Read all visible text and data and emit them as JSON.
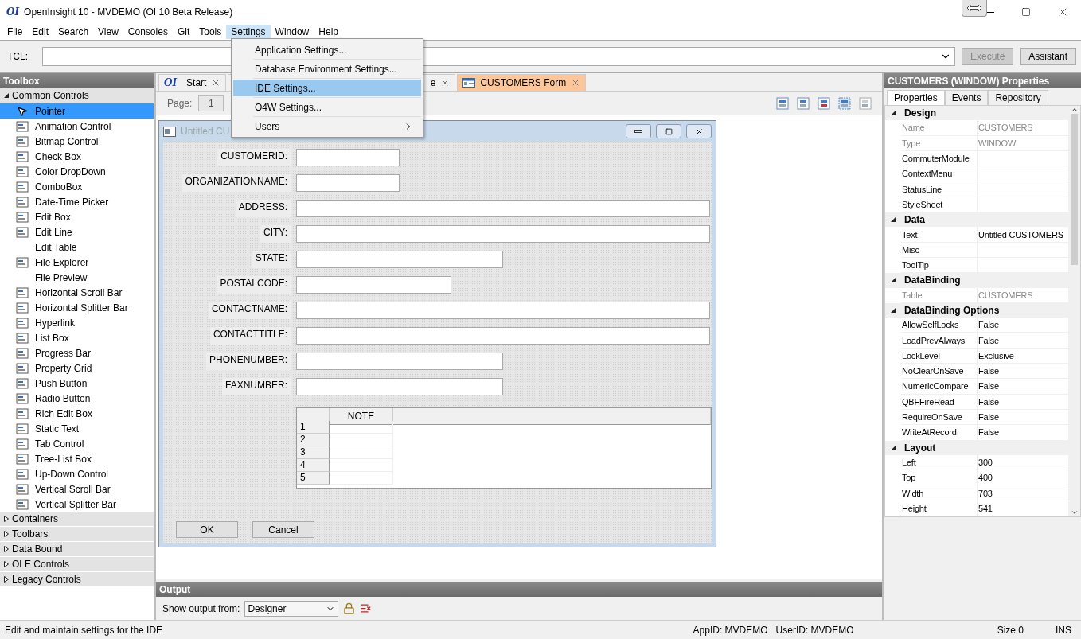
{
  "window": {
    "logo": "OI",
    "title": "OpenInsight 10 - MVDEMO (OI 10 Beta Release)"
  },
  "menu": [
    {
      "label": "File",
      "selected": false
    },
    {
      "label": "Edit",
      "selected": false
    },
    {
      "label": "Search",
      "selected": false
    },
    {
      "label": "View",
      "selected": false
    },
    {
      "label": "Consoles",
      "selected": false
    },
    {
      "label": "Git",
      "selected": false
    },
    {
      "label": "Tools",
      "selected": false
    },
    {
      "label": "Settings",
      "selected": true
    },
    {
      "label": "Window",
      "selected": false
    },
    {
      "label": "Help",
      "selected": false
    }
  ],
  "settings_menu": [
    {
      "label": "Application Settings...",
      "selected": false,
      "submenu": false
    },
    {
      "label": "Database Environment Settings...",
      "selected": false,
      "submenu": false
    },
    {
      "label": "IDE Settings...",
      "selected": true,
      "submenu": false
    },
    {
      "label": "O4W Settings...",
      "selected": false,
      "submenu": false
    },
    {
      "label": "Users",
      "selected": false,
      "submenu": true
    }
  ],
  "tcl": {
    "label": "TCL:",
    "execute": {
      "label": "Execute",
      "disabled": true
    },
    "assistant": {
      "label": "Assistant",
      "disabled": false
    }
  },
  "toolbox": {
    "title": "Toolbox",
    "groups": [
      {
        "label": "Common Controls",
        "expanded": true,
        "items": [
          {
            "label": "Pointer",
            "kind": "pointer",
            "selected": true
          },
          {
            "label": "Animation Control",
            "kind": "control",
            "selected": false
          },
          {
            "label": "Bitmap Control",
            "kind": "control",
            "selected": false
          },
          {
            "label": "Check Box",
            "kind": "control",
            "selected": false
          },
          {
            "label": "Color DropDown",
            "kind": "control",
            "selected": false
          },
          {
            "label": "ComboBox",
            "kind": "control",
            "selected": false
          },
          {
            "label": "Date-Time Picker",
            "kind": "control",
            "selected": false
          },
          {
            "label": "Edit Box",
            "kind": "control",
            "selected": false
          },
          {
            "label": "Edit Line",
            "kind": "control",
            "selected": false
          },
          {
            "label": "Edit Table",
            "kind": "plain",
            "selected": false
          },
          {
            "label": "File Explorer",
            "kind": "control",
            "selected": false
          },
          {
            "label": "File Preview",
            "kind": "plain",
            "selected": false
          },
          {
            "label": "Horizontal Scroll Bar",
            "kind": "control",
            "selected": false
          },
          {
            "label": "Horizontal Splitter Bar",
            "kind": "control",
            "selected": false
          },
          {
            "label": "Hyperlink",
            "kind": "control",
            "selected": false
          },
          {
            "label": "List Box",
            "kind": "control",
            "selected": false
          },
          {
            "label": "Progress Bar",
            "kind": "control",
            "selected": false
          },
          {
            "label": "Property Grid",
            "kind": "control",
            "selected": false
          },
          {
            "label": "Push Button",
            "kind": "control",
            "selected": false
          },
          {
            "label": "Radio Button",
            "kind": "control",
            "selected": false
          },
          {
            "label": "Rich Edit Box",
            "kind": "control",
            "selected": false
          },
          {
            "label": "Static Text",
            "kind": "control",
            "selected": false
          },
          {
            "label": "Tab Control",
            "kind": "control",
            "selected": false
          },
          {
            "label": "Tree-List Box",
            "kind": "control",
            "selected": false
          },
          {
            "label": "Up-Down Control",
            "kind": "control",
            "selected": false
          },
          {
            "label": "Vertical Scroll Bar",
            "kind": "control",
            "selected": false
          },
          {
            "label": "Vertical Splitter Bar",
            "kind": "control",
            "selected": false
          }
        ]
      },
      {
        "label": "Containers",
        "expanded": false
      },
      {
        "label": "Toolbars",
        "expanded": false
      },
      {
        "label": "Data Bound",
        "expanded": false
      },
      {
        "label": "OLE Controls",
        "expanded": false
      },
      {
        "label": "Legacy Controls",
        "expanded": false
      }
    ]
  },
  "tabs": [
    {
      "logo": "OI",
      "label": "Start",
      "selected": false
    },
    {
      "label": "e",
      "selected": false
    },
    {
      "label": "CUSTOMERS Form",
      "selected": true
    }
  ],
  "designer": {
    "page_label": "Page:",
    "page": "1",
    "form": {
      "title": "Untitled CU",
      "fields": [
        {
          "label": "CUSTOMERID:",
          "kind": "short"
        },
        {
          "label": "ORGANIZATIONNAME:",
          "kind": "short"
        },
        {
          "label": "ADDRESS:",
          "kind": "long"
        },
        {
          "label": "CITY:",
          "kind": "long"
        },
        {
          "label": "STATE:",
          "kind": "medium"
        },
        {
          "label": "POSTALCODE:",
          "kind": "postal"
        },
        {
          "label": "CONTACTNAME:",
          "kind": "long"
        },
        {
          "label": "CONTACTTITLE:",
          "kind": "long"
        },
        {
          "label": "PHONENUMBER:",
          "kind": "medium"
        },
        {
          "label": "FAXNUMBER:",
          "kind": "medium"
        }
      ],
      "table": {
        "columns": [
          "NOTE"
        ],
        "rows": [
          "1",
          "2",
          "3",
          "4",
          "5"
        ]
      },
      "buttons": [
        "OK",
        "Cancel"
      ]
    }
  },
  "output": {
    "title": "Output",
    "label": "Show output from:",
    "source": "Designer"
  },
  "properties": {
    "title": "CUSTOMERS (WINDOW) Properties",
    "tabs": [
      {
        "label": "Properties",
        "selected": true
      },
      {
        "label": "Events",
        "selected": false
      },
      {
        "label": "Repository",
        "selected": false
      }
    ],
    "categories": [
      {
        "label": "Design",
        "expanded": true,
        "rows": [
          {
            "name": "Name",
            "value": "CUSTOMERS",
            "disabled": true
          },
          {
            "name": "Type",
            "value": "WINDOW",
            "disabled": true
          },
          {
            "name": "CommuterModule",
            "disabled": false
          },
          {
            "name": "ContextMenu",
            "disabled": false
          },
          {
            "name": "StatusLine",
            "disabled": false
          },
          {
            "name": "StyleSheet",
            "disabled": false
          }
        ]
      },
      {
        "label": "Data",
        "expanded": true,
        "rows": [
          {
            "name": "Text",
            "value": "Untitled CUSTOMERS",
            "disabled": false
          },
          {
            "name": "Misc",
            "disabled": false
          },
          {
            "name": "ToolTip",
            "disabled": false
          }
        ]
      },
      {
        "label": "DataBinding",
        "expanded": true,
        "rows": [
          {
            "name": "Table",
            "value": "CUSTOMERS",
            "disabled": true
          }
        ]
      },
      {
        "label": "DataBinding Options",
        "expanded": true,
        "rows": [
          {
            "name": "AllowSelfLocks",
            "value": "False",
            "disabled": false
          },
          {
            "name": "LoadPrevAlways",
            "value": "False",
            "disabled": false
          },
          {
            "name": "LockLevel",
            "value": "Exclusive",
            "disabled": false
          },
          {
            "name": "NoClearOnSave",
            "value": "False",
            "disabled": false
          },
          {
            "name": "NumericCompare",
            "value": "False",
            "disabled": false
          },
          {
            "name": "QBFFireRead",
            "value": "False",
            "disabled": false
          },
          {
            "name": "RequireOnSave",
            "value": "False",
            "disabled": false
          },
          {
            "name": "WriteAtRecord",
            "value": "False",
            "disabled": false
          }
        ]
      },
      {
        "label": "Layout",
        "expanded": true,
        "rows": [
          {
            "name": "Left",
            "value": "300",
            "disabled": false
          },
          {
            "name": "Top",
            "value": "400",
            "disabled": false
          },
          {
            "name": "Width",
            "value": "703",
            "disabled": false
          },
          {
            "name": "Height",
            "value": "541",
            "disabled": false
          }
        ]
      }
    ]
  },
  "status_bar": {
    "message": "Edit and maintain settings for the IDE",
    "app_id": "AppID: MVDEMO",
    "user_id": "UserID: MVDEMO",
    "size": "Size 0",
    "mode": "INS"
  }
}
